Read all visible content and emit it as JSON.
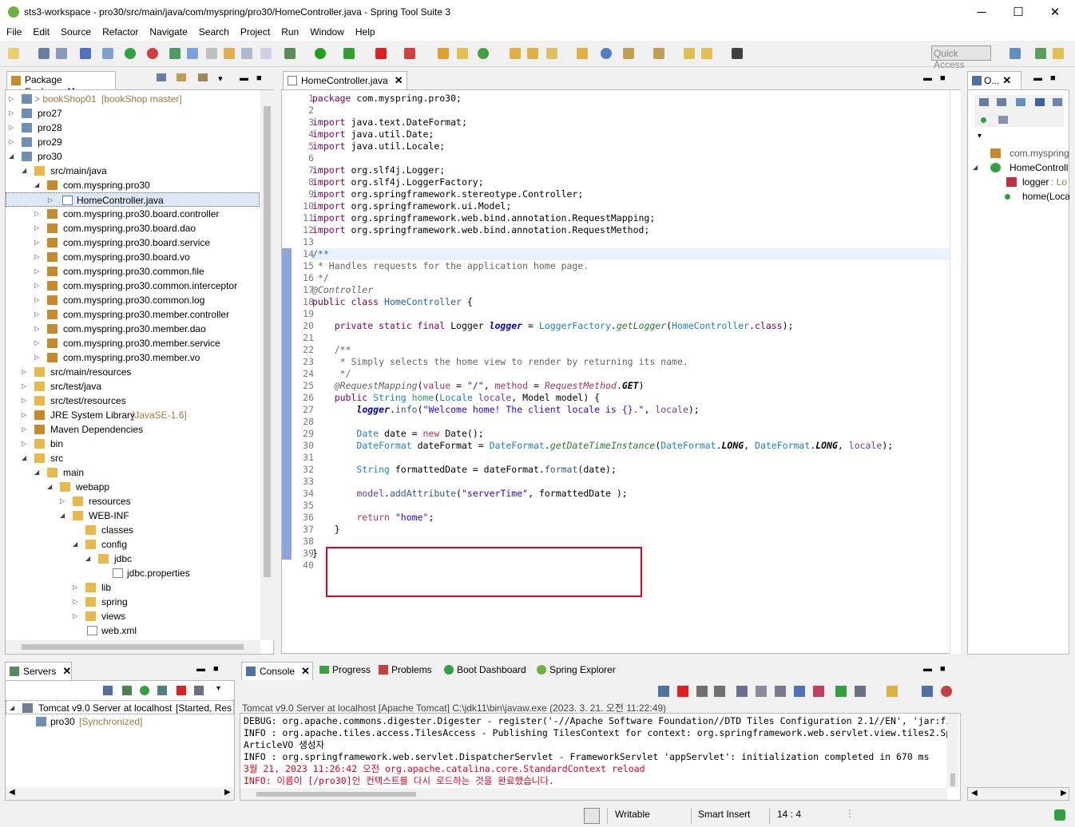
{
  "window": {
    "title": "sts3-workspace - pro30/src/main/java/com/myspring/pro30/HomeController.java - Spring Tool Suite 3",
    "minimize": "─",
    "maximize": "☐",
    "close": "✕"
  },
  "menu": [
    "File",
    "Edit",
    "Source",
    "Refactor",
    "Navigate",
    "Search",
    "Project",
    "Run",
    "Window",
    "Help"
  ],
  "toolbar": {
    "quick_access_placeholder": "Quick Access"
  },
  "package_explorer": {
    "tab_label": "Package Explorer",
    "items": [
      {
        "label": "> bookShop01",
        "suffix": " [bookShop master]"
      },
      {
        "label": "pro27"
      },
      {
        "label": "pro28"
      },
      {
        "label": "pro29"
      },
      {
        "label": "pro30"
      },
      {
        "label": "src/main/java"
      },
      {
        "label": "com.myspring.pro30"
      },
      {
        "label": "HomeController.java"
      },
      {
        "label": "com.myspring.pro30.board.controller"
      },
      {
        "label": "com.myspring.pro30.board.dao"
      },
      {
        "label": "com.myspring.pro30.board.service"
      },
      {
        "label": "com.myspring.pro30.board.vo"
      },
      {
        "label": "com.myspring.pro30.common.file"
      },
      {
        "label": "com.myspring.pro30.common.interceptor"
      },
      {
        "label": "com.myspring.pro30.common.log"
      },
      {
        "label": "com.myspring.pro30.member.controller"
      },
      {
        "label": "com.myspring.pro30.member.dao"
      },
      {
        "label": "com.myspring.pro30.member.service"
      },
      {
        "label": "com.myspring.pro30.member.vo"
      },
      {
        "label": "src/main/resources"
      },
      {
        "label": "src/test/java"
      },
      {
        "label": "src/test/resources"
      },
      {
        "label": "JRE System Library",
        "suffix": " [JavaSE-1.6]"
      },
      {
        "label": "Maven Dependencies"
      },
      {
        "label": "bin"
      },
      {
        "label": "src"
      },
      {
        "label": "main"
      },
      {
        "label": "webapp"
      },
      {
        "label": "resources"
      },
      {
        "label": "WEB-INF"
      },
      {
        "label": "classes"
      },
      {
        "label": "config"
      },
      {
        "label": "jdbc"
      },
      {
        "label": "jdbc.properties"
      },
      {
        "label": "lib"
      },
      {
        "label": "spring"
      },
      {
        "label": "views"
      },
      {
        "label": "web.xml"
      }
    ]
  },
  "editor": {
    "tab_label": "HomeController.java",
    "lines": [
      "1",
      "2",
      "3",
      "4",
      "5",
      "6",
      "7",
      "8",
      "9",
      "10",
      "11",
      "12",
      "13",
      "14",
      "15",
      "16",
      "17",
      "18",
      "19",
      "20",
      "21",
      "22",
      "23",
      "24",
      "25",
      "26",
      "27",
      "28",
      "29",
      "30",
      "31",
      "32",
      "33",
      "34",
      "35",
      "36",
      "37",
      "38",
      "39",
      "40"
    ],
    "code": {
      "l1a": "package",
      "l1b": " com.myspring.pro30;",
      "imp": "import",
      "l3": " java.text.DateFormat;",
      "l4": " java.util.Date;",
      "l5": " java.util.Locale;",
      "l7": " org.slf4j.Logger;",
      "l8": " org.slf4j.LoggerFactory;",
      "l9": " org.springframework.stereotype.Controller;",
      "l10": " org.springframework.ui.Model;",
      "l11": " org.springframework.web.bind.annotation.RequestMapping;",
      "l12": " org.springframework.web.bind.annotation.RequestMethod;",
      "l14": "/**",
      "l15": " * Handles requests for the application home page.",
      "l16": " */",
      "l17": "@Controller",
      "l18a": "public class",
      "l18b": " HomeController",
      "l18c": " {",
      "l20a": "    private static final",
      "l20b": " Logger ",
      "l20c": "logger",
      "l20d": " = ",
      "l20e": "LoggerFactory",
      "l20f": ".",
      "l20g": "getLogger",
      "l20h": "(",
      "l20i": "HomeController",
      "l20j": ".",
      "l20k": "class",
      "l20l": ");",
      "l22": "    /**",
      "l23": "     * Simply selects the home view to render by returning its name.",
      "l24": "     */",
      "l25a": "    @RequestMapping",
      "l25b": "(",
      "l25c": "value",
      "l25d": " = ",
      "l25e": "\"/\"",
      "l25f": ", ",
      "l25g": "method",
      "l25h": " = ",
      "l25i": "RequestMethod",
      "l25j": ".",
      "l25k": "GET",
      "l25l": ")",
      "l26a": "    public",
      "l26b": " String ",
      "l26c": "home",
      "l26d": "(",
      "l26e": "Locale ",
      "l26f": "locale",
      "l26g": ", Model ",
      "l26h": "model",
      "l26i": ") {",
      "l27a": "        ",
      "l27b": "logger",
      "l27c": ".",
      "l27d": "info",
      "l27e": "(",
      "l27f": "\"Welcome home! The client locale is {}.\"",
      "l27g": ", ",
      "l27h": "locale",
      "l27i": ");",
      "l29a": "        ",
      "l29b": "Date ",
      "l29c": "date",
      "l29d": " = ",
      "l29e": "new",
      "l29f": " Date",
      "l29g": "();",
      "l30a": "        ",
      "l30b": "DateFormat ",
      "l30c": "dateFormat",
      "l30d": " = ",
      "l30e": "DateFormat",
      "l30f": ".",
      "l30g": "getDateTimeInstance",
      "l30h": "(",
      "l30i": "DateFormat",
      "l30j": ".",
      "l30k": "LONG",
      "l30l": ", ",
      "l30m": "DateFormat",
      "l30n": ".",
      "l30o": "LONG",
      "l30p": ", ",
      "l30q": "locale",
      "l30r": ");",
      "l32a": "        ",
      "l32b": "String ",
      "l32c": "formattedDate",
      "l32d": " = ",
      "l32e": "dateFormat",
      "l32f": ".",
      "l32g": "format",
      "l32h": "(",
      "l32i": "date",
      "l32j": ");",
      "l34a": "        ",
      "l34b": "model",
      "l34c": ".",
      "l34d": "addAttribute",
      "l34e": "(",
      "l34f": "\"serverTime\"",
      "l34g": ", ",
      "l34h": "formattedDate",
      "l34i": " );",
      "l36a": "        return",
      "l36b": " ",
      "l36c": "\"home\"",
      "l36d": ";",
      "l37": "    }",
      "l39": "}"
    }
  },
  "outline": {
    "tab_label": "O...",
    "items": [
      {
        "label": "com.myspring"
      },
      {
        "label": "HomeControll"
      },
      {
        "label": "logger",
        "suffix": " : Lo"
      },
      {
        "label": "home(Loca"
      }
    ]
  },
  "servers": {
    "tab_label": "Servers",
    "items": [
      {
        "label": "Tomcat v9.0 Server at localhost",
        "suffix": "  [Started, Res"
      },
      {
        "label": "pro30",
        "suffix": "  [Synchronized]"
      }
    ]
  },
  "console": {
    "tabs": [
      "Console",
      "Progress",
      "Problems",
      "Boot Dashboard",
      "Spring Explorer"
    ],
    "header": "Tomcat v9.0 Server at localhost [Apache Tomcat] C:\\jdk11\\bin\\javaw.exe (2023. 3. 21. 오전 11:22:49)",
    "lines": [
      "DEBUG: org.apache.commons.digester.Digester - register('-//Apache Software Foundation//DTD Tiles Configuration 2.1//EN', 'jar:fi",
      "INFO : org.apache.tiles.access.TilesAccess - Publishing TilesContext for context: org.springframework.web.servlet.view.tiles2.Sp",
      "ArticleVO 생성자",
      "INFO : org.springframework.web.servlet.DispatcherServlet - FrameworkServlet 'appServlet': initialization completed in 670 ms",
      "3월 21, 2023 11:26:42 오전 org.apache.catalina.core.StandardContext reload",
      "INFO: 이름이 [/pro30]인 컨텍스트를 다시 로드하는 것을 완료했습니다."
    ]
  },
  "status": {
    "writable": "Writable",
    "insert": "Smart Insert",
    "position": "14 : 4"
  },
  "colors": {
    "highlight_box": "#e0001b",
    "keyword": "#7f0055",
    "string": "#2a00ff",
    "comment": "#3f7f5f",
    "field": "#0000c0",
    "error_text": "#e0001b"
  }
}
